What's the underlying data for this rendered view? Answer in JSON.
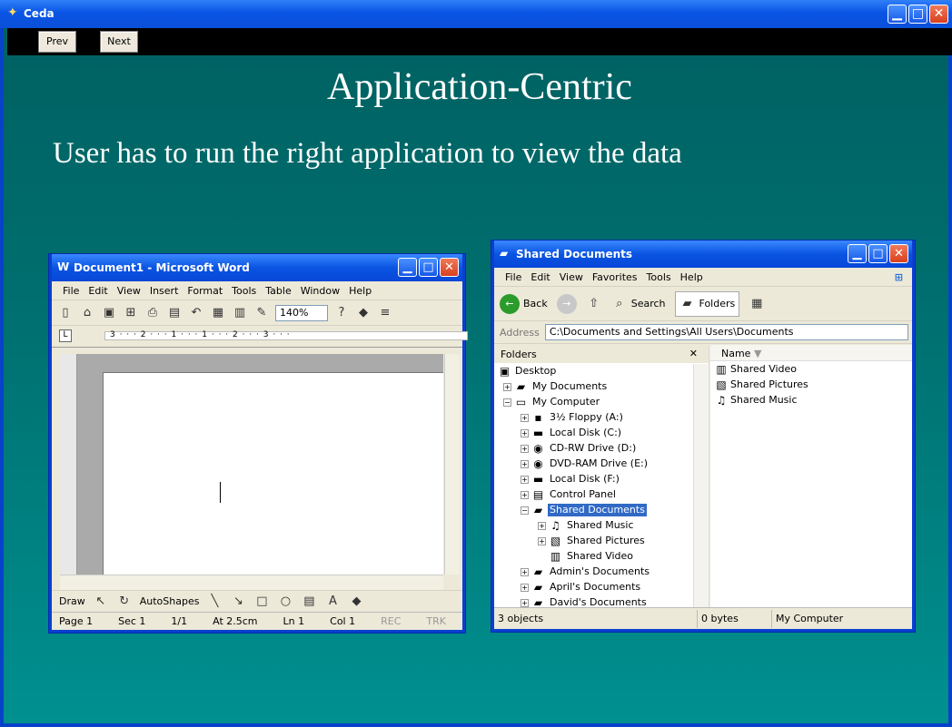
{
  "app": {
    "title": "Ceda",
    "nav": {
      "prev": "Prev",
      "next": "Next"
    }
  },
  "slide": {
    "title": "Application-Centric",
    "text": "User has to run the right application to view the data"
  },
  "word": {
    "title": "Document1 - Microsoft Word",
    "menu": [
      "File",
      "Edit",
      "View",
      "Insert",
      "Format",
      "Tools",
      "Table",
      "Window",
      "Help"
    ],
    "zoom": "140%",
    "ruler": "3 · · · 2 · · · 1 · · · 1 · · · 2 · · · 3 · · ·",
    "draw": "Draw",
    "autoshapes": "AutoShapes",
    "status": [
      "Page 1",
      "Sec 1",
      "1/1",
      "At 2.5cm",
      "Ln 1",
      "Col 1",
      "REC",
      "TRK"
    ]
  },
  "explorer": {
    "title": "Shared Documents",
    "menu": [
      "File",
      "Edit",
      "View",
      "Favorites",
      "Tools",
      "Help"
    ],
    "toolbar": {
      "back": "Back",
      "search": "Search",
      "folders": "Folders"
    },
    "address_label": "Address",
    "address": "C:\\Documents and Settings\\All Users\\Documents",
    "folders_label": "Folders",
    "name_header": "Name",
    "tree": [
      {
        "label": "Desktop",
        "icon": "desktop-icon"
      },
      {
        "label": "My Documents",
        "icon": "folder-icon"
      },
      {
        "label": "My Computer",
        "icon": "computer-icon"
      },
      {
        "label": "3½ Floppy (A:)",
        "icon": "floppy-icon"
      },
      {
        "label": "Local Disk (C:)",
        "icon": "disk-icon"
      },
      {
        "label": "CD-RW Drive (D:)",
        "icon": "cd-icon"
      },
      {
        "label": "DVD-RAM Drive (E:)",
        "icon": "dvd-icon"
      },
      {
        "label": "Local Disk (F:)",
        "icon": "disk-icon"
      },
      {
        "label": "Control Panel",
        "icon": "control-panel-icon"
      },
      {
        "label": "Shared Documents",
        "icon": "folder-icon",
        "selected": true
      },
      {
        "label": "Shared Music",
        "icon": "music-folder-icon"
      },
      {
        "label": "Shared Pictures",
        "icon": "pictures-folder-icon"
      },
      {
        "label": "Shared Video",
        "icon": "video-folder-icon"
      },
      {
        "label": "Admin's Documents",
        "icon": "folder-icon"
      },
      {
        "label": "April's Documents",
        "icon": "folder-icon"
      },
      {
        "label": "David's Documents",
        "icon": "folder-icon"
      }
    ],
    "files": [
      "Shared Video",
      "Shared Pictures",
      "Shared Music"
    ],
    "status": {
      "objects": "3 objects",
      "size": "0 bytes",
      "location": "My Computer"
    }
  }
}
